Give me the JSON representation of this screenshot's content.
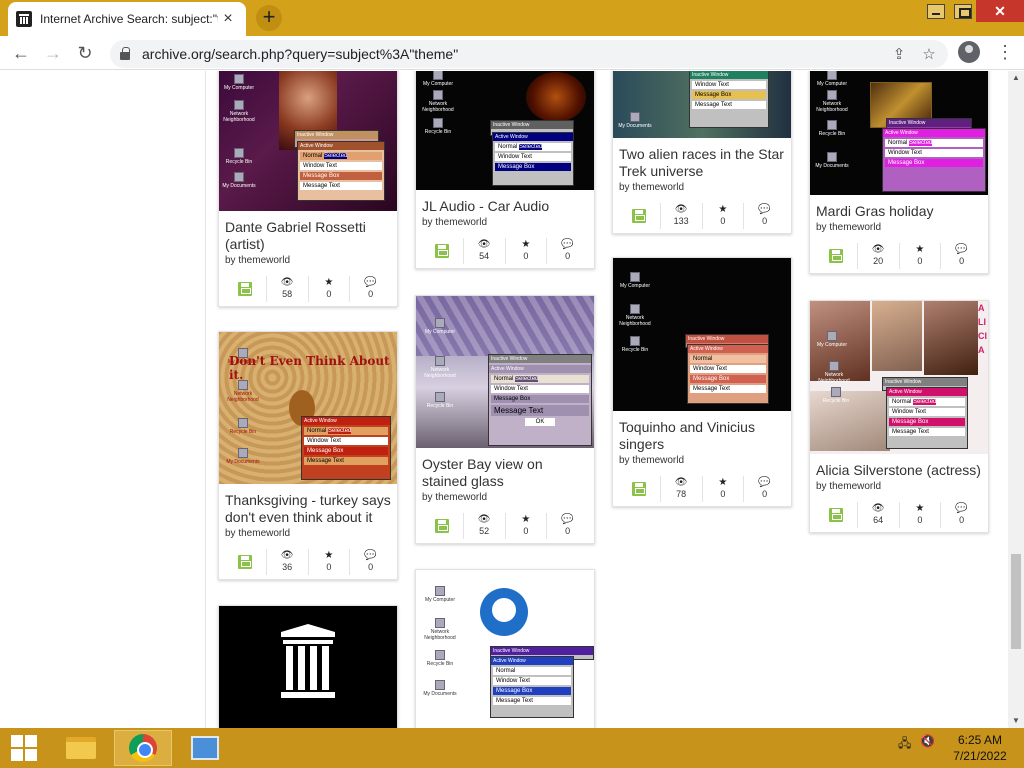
{
  "browser": {
    "tab_title": "Internet Archive Search: subject:\"theme\"",
    "tab_close": "×",
    "new_tab": "+",
    "url": "archive.org/search.php?query=subject%3A\"theme\"",
    "nav": {
      "back": "←",
      "forward": "→",
      "reload": "↻"
    },
    "share_icon": "⇪",
    "star_icon": "☆",
    "menu_icon": "⋮",
    "window": {
      "close": "✕"
    }
  },
  "results": [
    {
      "title": "Dante Gabriel Rossetti (artist)",
      "by": "by themeworld",
      "views": "58",
      "favs": "0",
      "reviews": "0"
    },
    {
      "title": "JL Audio - Car Audio",
      "by": "by themeworld",
      "views": "54",
      "favs": "0",
      "reviews": "0"
    },
    {
      "title": "Two alien races in the Star Trek universe",
      "by": "by themeworld",
      "views": "133",
      "favs": "0",
      "reviews": "0"
    },
    {
      "title": "Mardi Gras holiday",
      "by": "by themeworld",
      "views": "20",
      "favs": "0",
      "reviews": "0"
    },
    {
      "title": "Thanksgiving - turkey says don't even think about it",
      "by": "by themeworld",
      "views": "36",
      "favs": "0",
      "reviews": "0"
    },
    {
      "title": "Oyster Bay view on stained glass",
      "by": "by themeworld",
      "views": "52",
      "favs": "0",
      "reviews": "0"
    },
    {
      "title": "Toquinho and Vinicius singers",
      "by": "by themeworld",
      "views": "78",
      "favs": "0",
      "reviews": "0"
    },
    {
      "title": "Alicia Silverstone (actress)",
      "by": "by themeworld",
      "views": "64",
      "favs": "0",
      "reviews": "0"
    }
  ],
  "icons": {
    "views": "👁",
    "favs": "★",
    "reviews": "💬"
  },
  "thumb_text": {
    "my_computer": "My Computer",
    "network": "Network Neighborhood",
    "recycle": "Recycle Bin",
    "my_documents": "My Documents",
    "inactive": "Inactive Window",
    "active": "Active Window",
    "normal": "Normal",
    "selected": "Selected",
    "window_text": "Window Text",
    "message_box": "Message Box",
    "message_text": "Message Text",
    "ok": "OK",
    "thanksgiving_banner": "Don't Even Think About it.",
    "alicia_side": "ALICIA"
  },
  "taskbar": {
    "time": "6:25 AM",
    "date": "7/21/2022"
  },
  "colors": {
    "titlebar": "#d4a21a",
    "taskbar": "#c8931a",
    "save_green": "#8bc34a"
  }
}
